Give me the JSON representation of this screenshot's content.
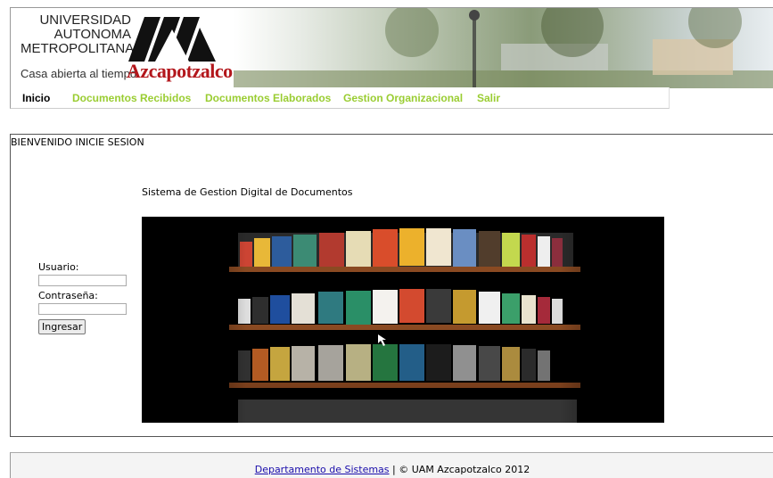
{
  "header": {
    "university_line1": "UNIVERSIDAD",
    "university_line2": "AUTONOMA",
    "university_line3": "METROPOLITANA",
    "tagline": "Casa abierta al tiempo",
    "campus": "Azcapotzalco",
    "logo_mark_letters": "UAM"
  },
  "nav": {
    "items": [
      {
        "label": "Inicio",
        "active": true
      },
      {
        "label": "Documentos Recibidos",
        "active": false
      },
      {
        "label": "Documentos Elaborados",
        "active": false
      },
      {
        "label": "Gestion Organizacional",
        "active": false
      },
      {
        "label": "Salir",
        "active": false
      }
    ]
  },
  "main": {
    "welcome": "BIENVENIDO INICIE SESION",
    "subtitle": "Sistema de Gestion Digital de Documentos"
  },
  "login": {
    "user_label": "Usuario:",
    "user_value": "",
    "password_label": "Contraseña:",
    "password_value": "",
    "submit_label": "Ingresar"
  },
  "footer": {
    "link_text": "Departamento de Sistemas",
    "separator": " | ",
    "copyright": "© UAM Azcapotzalco 2012"
  },
  "colors": {
    "nav_link": "#9acd32",
    "campus_red": "#b3171c",
    "footer_link": "#1a0dab"
  }
}
